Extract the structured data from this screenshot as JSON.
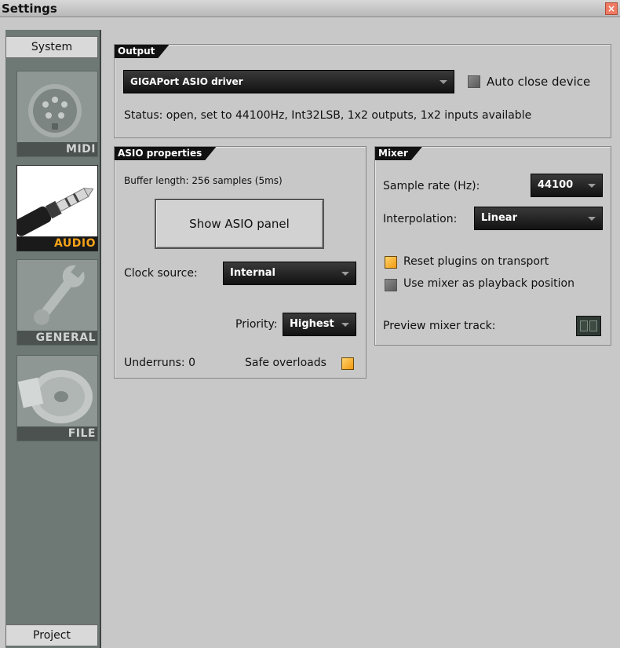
{
  "window": {
    "title": "Settings",
    "close_glyph": "×"
  },
  "sidebar": {
    "top_tab": "System",
    "bottom_tab": "Project",
    "categories": [
      {
        "label": "MIDI",
        "icon": "midi-connector-icon",
        "active": false
      },
      {
        "label": "AUDIO",
        "icon": "audio-jack-icon",
        "active": true
      },
      {
        "label": "GENERAL",
        "icon": "wrench-icon",
        "active": false
      },
      {
        "label": "FILE",
        "icon": "disc-icon",
        "active": false
      }
    ]
  },
  "output": {
    "heading": "Output",
    "driver_value": "GIGAPort ASIO driver",
    "auto_close_label": "Auto close device",
    "auto_close_checked": false,
    "status": "Status: open, set to 44100Hz, Int32LSB, 1x2 outputs, 1x2 inputs available"
  },
  "asio": {
    "heading": "ASIO properties",
    "buffer_length": "Buffer length: 256 samples (5ms)",
    "show_panel_label": "Show ASIO panel",
    "clock_source_label": "Clock source:",
    "clock_source_value": "Internal",
    "priority_label": "Priority:",
    "priority_value": "Highest",
    "underruns": "Underruns: 0",
    "safe_overloads_label": "Safe overloads",
    "safe_overloads_checked": true
  },
  "mixer": {
    "heading": "Mixer",
    "sample_rate_label": "Sample rate (Hz):",
    "sample_rate_value": "44100",
    "interpolation_label": "Interpolation:",
    "interpolation_value": "Linear",
    "reset_plugins_label": "Reset plugins on transport",
    "reset_plugins_checked": true,
    "use_mixer_label": "Use mixer as playback position",
    "use_mixer_checked": false,
    "preview_track_label": "Preview mixer track:",
    "preview_track_value": "--"
  }
}
